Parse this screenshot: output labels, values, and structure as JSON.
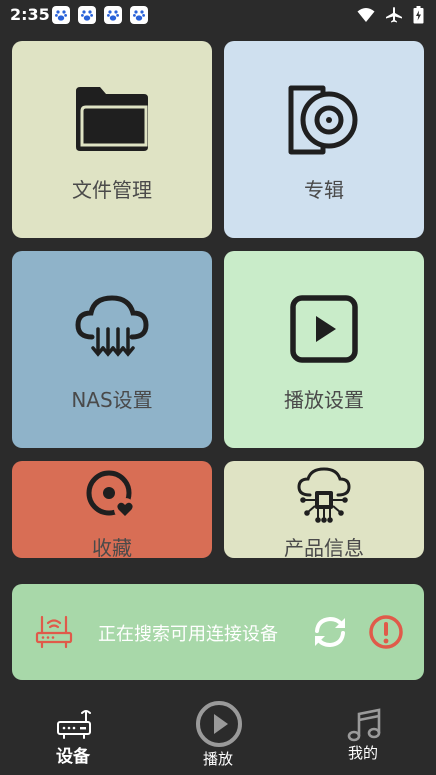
{
  "status_bar": {
    "time": "2:35",
    "notification_icons": [
      "baidu-paw-icon",
      "baidu-paw-icon",
      "baidu-paw-icon",
      "baidu-paw-icon"
    ],
    "right_icons": [
      "wifi-icon",
      "airplane-icon",
      "battery-charging-icon"
    ]
  },
  "tiles": [
    {
      "label": "文件管理",
      "icon": "folder-icon",
      "color": "#dfe3c4"
    },
    {
      "label": "专辑",
      "icon": "disc-icon",
      "color": "#cfe0ef"
    },
    {
      "label": "NAS设置",
      "icon": "cloud-download-icon",
      "color": "#8fb3c9"
    },
    {
      "label": "播放设置",
      "icon": "play-square-icon",
      "color": "#c9ecc9"
    },
    {
      "label": "收藏",
      "icon": "favorite-disc-icon",
      "color": "#d86e55"
    },
    {
      "label": "产品信息",
      "icon": "cloud-chip-icon",
      "color": "#dfe3c4"
    }
  ],
  "search_card": {
    "text": "正在搜索可用连接设备",
    "color": "#a8d8a9",
    "icons": [
      "router-icon",
      "refresh-icon",
      "alert-icon"
    ]
  },
  "bottom_nav": {
    "items": [
      {
        "label": "设备",
        "icon": "device-icon",
        "active": true
      },
      {
        "label": "播放",
        "icon": "play-circle-icon",
        "active": false
      },
      {
        "label": "我的",
        "icon": "music-note-icon",
        "active": false
      }
    ]
  }
}
